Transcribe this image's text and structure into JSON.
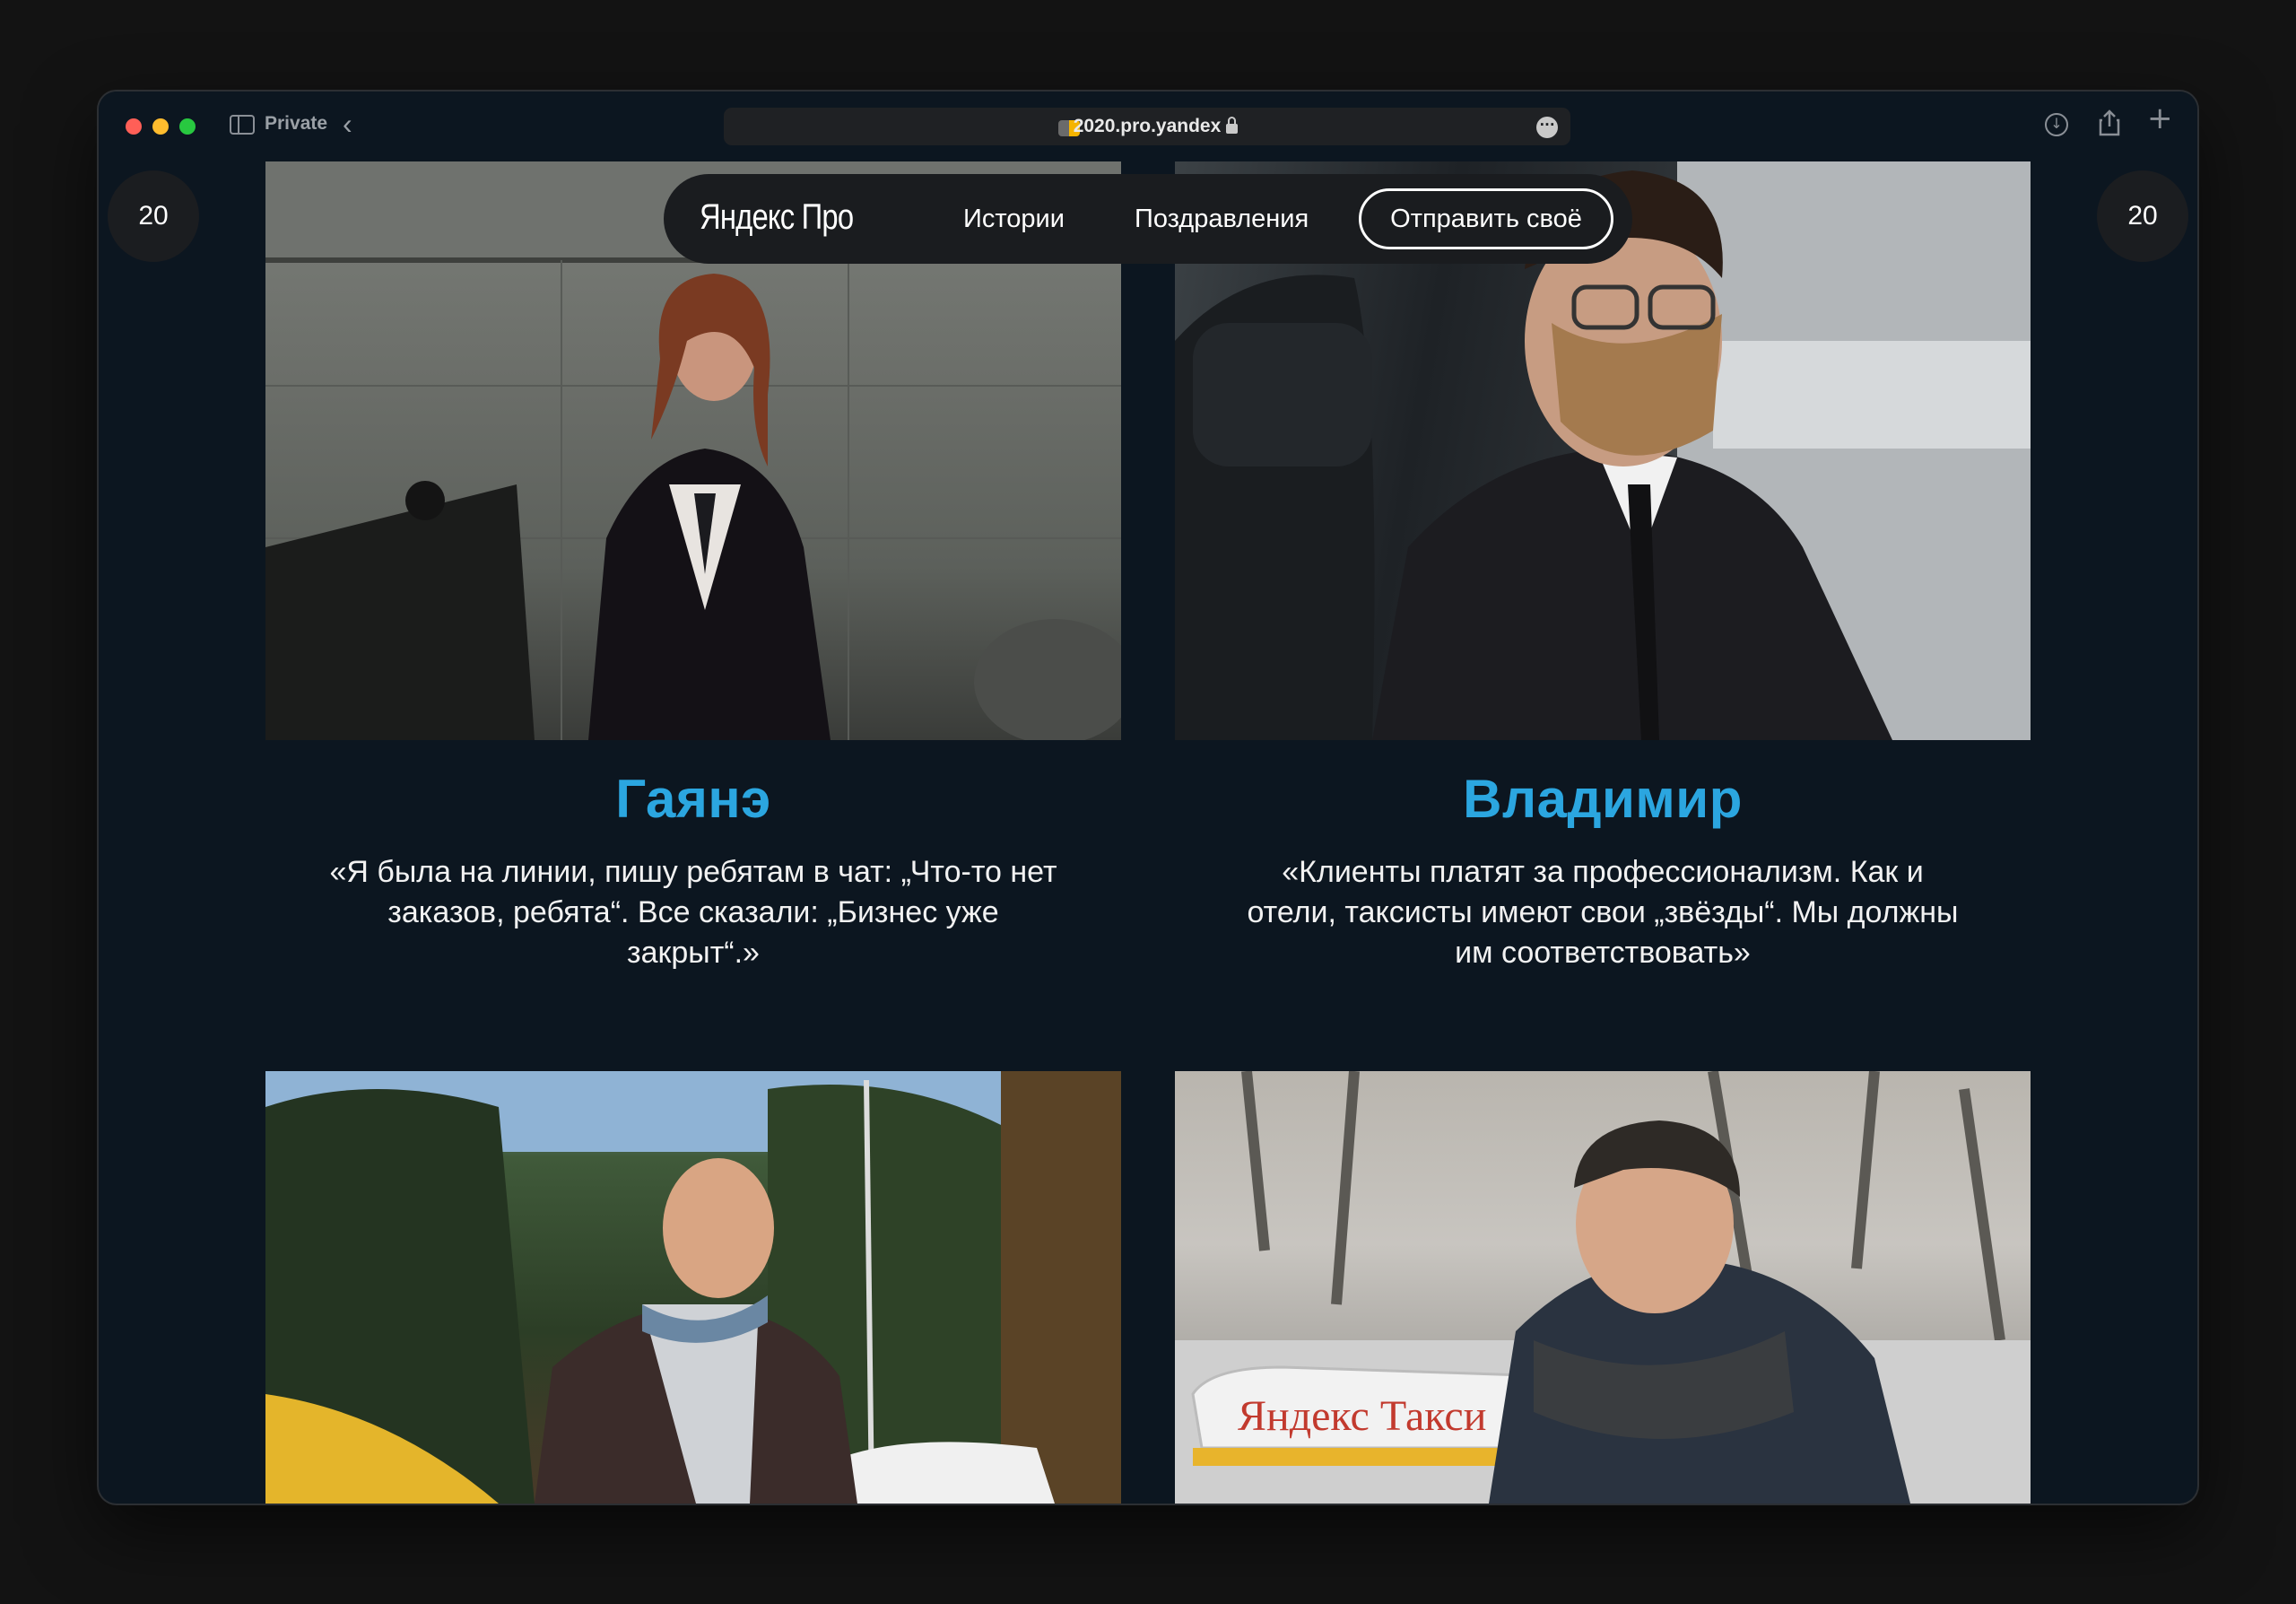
{
  "browser": {
    "private_label": "Private",
    "url": "2020.pro.yandex"
  },
  "side_counters": {
    "left": "20",
    "right": "20"
  },
  "nav": {
    "logo": "Яндекс Про",
    "stories": "Истории",
    "congrats": "Поздравления",
    "send": "Отправить своё"
  },
  "stories": [
    {
      "name": "Гаянэ",
      "quote": "«Я была на линии, пишу ребятам в чат: „Что-то нет заказов, ребята“. Все сказали: „Бизнес уже закрыт“.»"
    },
    {
      "name": "Владимир",
      "quote": "«Клиенты платят за профессионализм. Как и отели, таксисты имеют свои „звёзды“. Мы должны им соответствовать»"
    }
  ],
  "photo_captions": {
    "taxi_sign": "Яндекс Такси"
  },
  "colors": {
    "page_bg": "#0c1620",
    "accent": "#2ba6e0",
    "nav_bg": "#1a1c1f"
  }
}
